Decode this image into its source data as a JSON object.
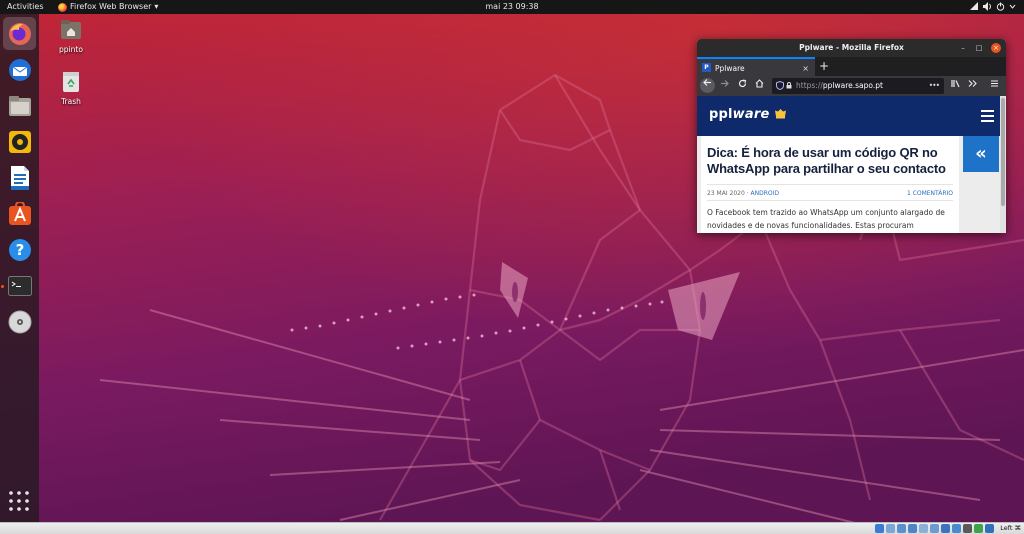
{
  "topbar": {
    "activities": "Activities",
    "app_name": "Firefox Web Browser",
    "app_menu_arrow": "▾",
    "clock": "mai 23  09:38"
  },
  "dock": {
    "items": [
      {
        "name": "firefox",
        "icon": "firefox-icon",
        "active": true
      },
      {
        "name": "thunderbird",
        "icon": "thunderbird-icon"
      },
      {
        "name": "files",
        "icon": "files-icon"
      },
      {
        "name": "rhythmbox",
        "icon": "rhythmbox-icon"
      },
      {
        "name": "libreoffice-writer",
        "icon": "writer-icon"
      },
      {
        "name": "ubuntu-software",
        "icon": "software-icon"
      },
      {
        "name": "help",
        "icon": "help-icon"
      },
      {
        "name": "terminal",
        "icon": "terminal-icon",
        "running": true
      },
      {
        "name": "dvd",
        "icon": "disc-icon"
      }
    ],
    "show_apps_icon": "grid-icon"
  },
  "desktop": {
    "home_label": "ppinto",
    "trash_label": "Trash"
  },
  "firefox": {
    "window_title": "Pplware - Mozilla Firefox",
    "tab_title": "Pplware",
    "tab_favicon": "P",
    "tab_close": "×",
    "new_tab": "+",
    "url_prefix": "https://",
    "url_host": "pplware.sapo.pt",
    "url_menu": "•••",
    "window_buttons": {
      "minimize": "–",
      "maximize": "□",
      "close": "×"
    }
  },
  "page": {
    "logo_main": "ppl",
    "logo_ware": "ware",
    "article_title": "Dica: É hora de usar um código QR no WhatsApp para partilhar o seu contacto",
    "date": "23 MAI 2020",
    "meta_separator": " · ",
    "category": "ANDROID",
    "comments": "1 COMENTÁRIO",
    "body": "O Facebook tem trazido ao WhatsApp um conjunto alargado de novidades e de novas funcionalidades. Estas procuram",
    "side_toggle": "«"
  },
  "statusbar": {
    "host_key": "Left ⌘"
  },
  "colors": {
    "wallpaper_top": "#c22b31",
    "wallpaper_bottom": "#6b1a5a",
    "ubuntu_orange": "#e95420",
    "firefox_blue": "#0a84ff",
    "site_header": "#0e2a6b"
  }
}
